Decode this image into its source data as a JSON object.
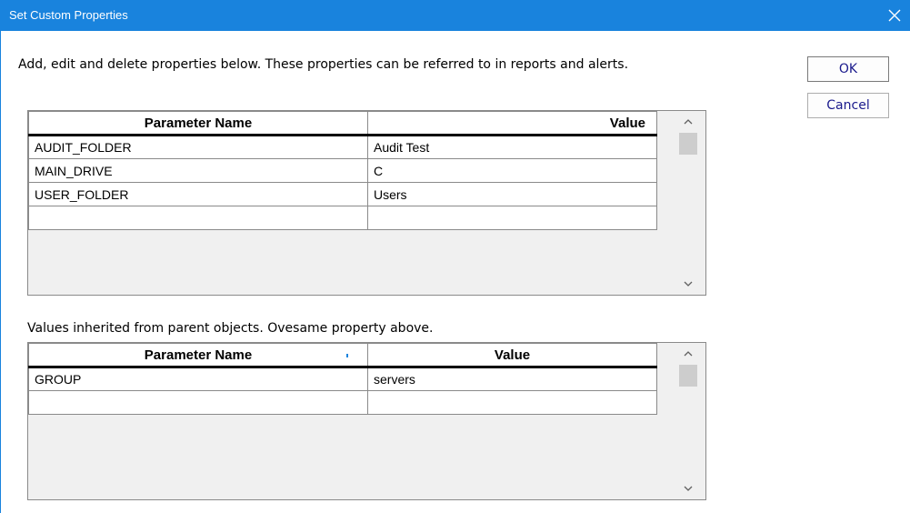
{
  "window": {
    "title": "Set Custom Properties",
    "close_icon": "close-icon",
    "accent_color": "#1983dd"
  },
  "intro_text": "Add, edit and delete properties below.  These properties can be referred to in reports and alerts.",
  "buttons": {
    "ok": "OK",
    "cancel": "Cancel"
  },
  "properties_grid": {
    "headers": [
      "Parameter Name",
      "Value"
    ],
    "rows": [
      [
        "AUDIT_FOLDER",
        "Audit Test"
      ],
      [
        "MAIN_DRIVE",
        "C"
      ],
      [
        "USER_FOLDER",
        "Users"
      ],
      [
        "",
        ""
      ]
    ]
  },
  "inherited_text": "Values inherited from parent objects.  Ovesame property above.",
  "inherited_grid": {
    "headers": [
      "Parameter Name",
      "Value"
    ],
    "rows": [
      [
        "GROUP",
        "servers"
      ],
      [
        "",
        ""
      ]
    ]
  }
}
